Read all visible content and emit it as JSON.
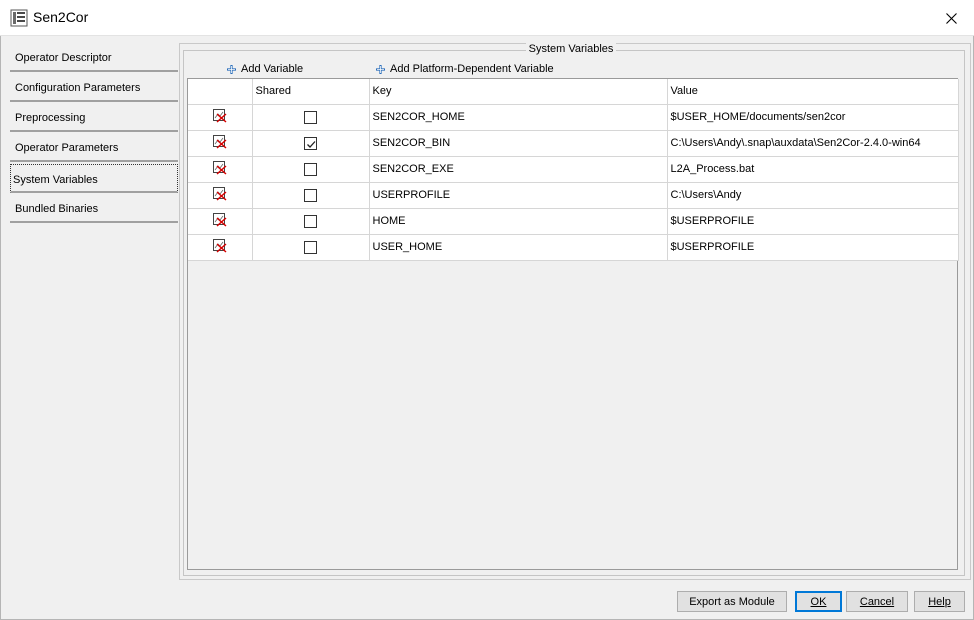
{
  "window": {
    "title": "Sen2Cor",
    "icon": "sen2cor-app-icon",
    "close_icon": "close-icon"
  },
  "sidebar": {
    "items": [
      {
        "label": "Operator Descriptor",
        "selected": false
      },
      {
        "label": "Configuration Parameters",
        "selected": false
      },
      {
        "label": "Preprocessing",
        "selected": false
      },
      {
        "label": "Operator Parameters",
        "selected": false
      },
      {
        "label": "System Variables",
        "selected": true
      },
      {
        "label": "Bundled Binaries",
        "selected": false
      }
    ]
  },
  "panel": {
    "group_title": "System Variables",
    "add_variable_label": "Add Variable",
    "add_platform_variable_label": "Add Platform-Dependent Variable",
    "add_icon": "plus-icon"
  },
  "table": {
    "columns": [
      "",
      "Shared",
      "Key",
      "Value"
    ],
    "delete_icon": "delete-row-icon",
    "rows": [
      {
        "shared": false,
        "key": "SEN2COR_HOME",
        "value": "$USER_HOME/documents/sen2cor"
      },
      {
        "shared": true,
        "key": "SEN2COR_BIN",
        "value": "C:\\Users\\Andy\\.snap\\auxdata\\Sen2Cor-2.4.0-win64"
      },
      {
        "shared": false,
        "key": "SEN2COR_EXE",
        "value": "L2A_Process.bat"
      },
      {
        "shared": false,
        "key": "USERPROFILE",
        "value": "C:\\Users\\Andy"
      },
      {
        "shared": false,
        "key": "HOME",
        "value": "$USERPROFILE"
      },
      {
        "shared": false,
        "key": "USER_HOME",
        "value": "$USERPROFILE"
      }
    ]
  },
  "buttons": {
    "export_label": "Export as Module",
    "ok_label": "OK",
    "cancel_label": "Cancel",
    "help_label": "Help"
  },
  "colors": {
    "background": "#f0f0f0",
    "accent": "#0078d7",
    "delete_red": "#d40000",
    "plus_blue": "#2a6ebb"
  }
}
